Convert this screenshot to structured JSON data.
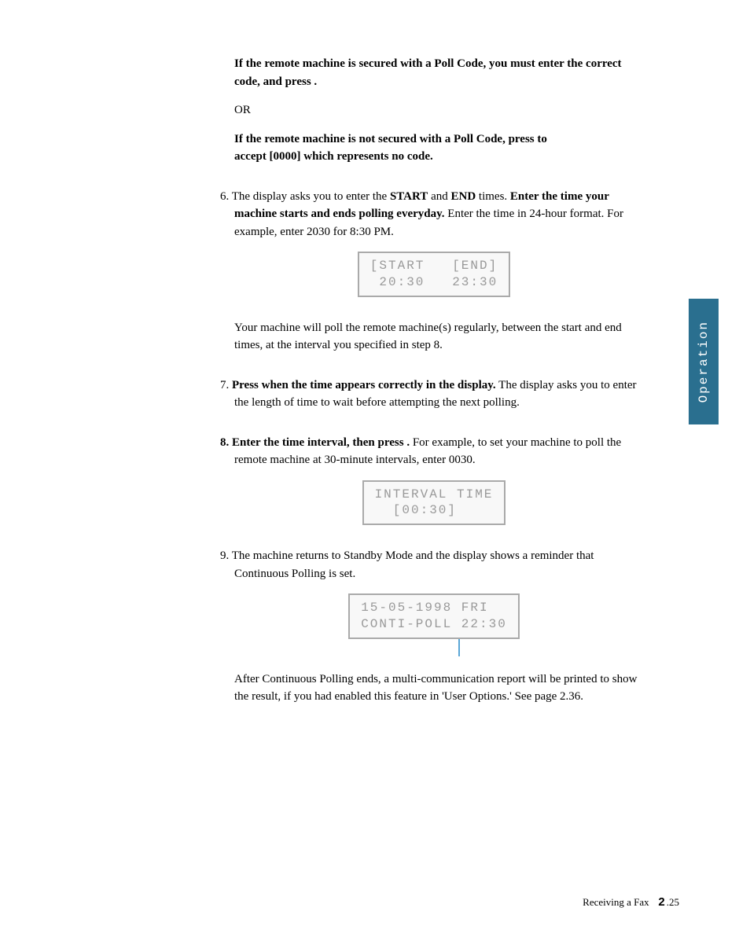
{
  "p_pollcode": "If the remote machine is secured with a Poll Code, you must enter the correct code, and press        .",
  "p_or": "OR",
  "p_nocode_1": "If the remote machine is not secured with a Poll Code, press          to",
  "p_nocode_2": "accept [0000] which represents no code.",
  "step6_a": "6. The display asks you to enter the ",
  "step6_start": "START",
  "step6_b": " and ",
  "step6_end": "END",
  "step6_c": " times. ",
  "step6_bold": "Enter the time your machine starts and ends polling everyday.",
  "step6_d": " Enter the time in 24-hour format. For example, enter 2030 for 8:30 PM.",
  "lcd1": "[START   [END]\n 20:30   23:30",
  "step6_after": "Your machine will poll the remote machine(s) regularly, between the start and end times, at the interval you specified in step 8.",
  "step7_a": "7. ",
  "step7_bold": "Press          when the time appears correctly in the display.",
  "step7_b": " The display asks you to enter the length of time to wait before attempting the next polling.",
  "step8_a": "8. Enter the time interval, then press          .",
  "step8_b": " For example, to set your machine to poll the remote machine at 30-minute intervals, enter 0030.",
  "lcd2": "INTERVAL TIME\n  [00:30]    ",
  "step9": "9. The machine returns to Standby Mode and the display shows a reminder that Continuous Polling is set.",
  "lcd3": "15-05-1998 FRI  \nCONTI-POLL 22:30",
  "step9_after": "After Continuous Polling ends, a multi-communication report will be printed to show the result, if you had enabled this feature in 'User Options.' See page 2.36.",
  "sidetab": "Operation",
  "footer_section": "Receiving a Fax",
  "footer_chapter": "2",
  "footer_page": ".25"
}
